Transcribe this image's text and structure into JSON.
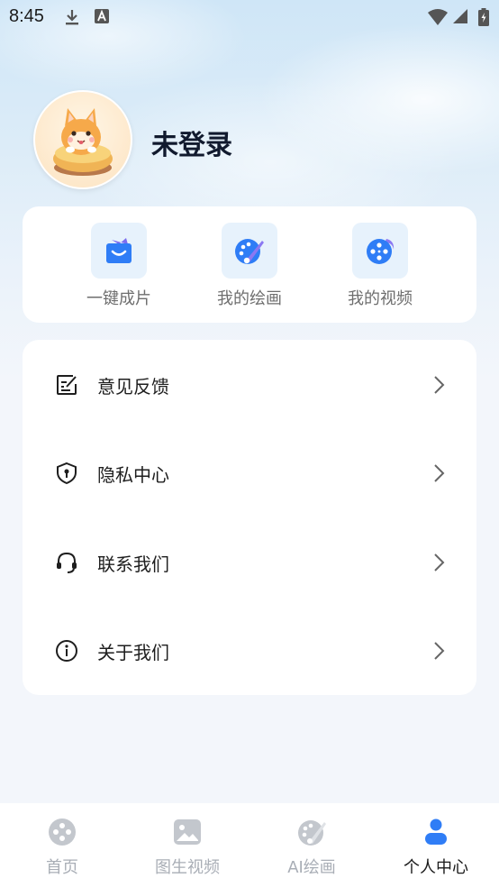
{
  "status_bar": {
    "time": "8:45",
    "icons": [
      "download-icon",
      "font-a-icon",
      "wifi-icon",
      "cell-signal-icon",
      "battery-charging-icon"
    ]
  },
  "profile": {
    "username": "未登录",
    "avatar": "cat-on-donut-avatar"
  },
  "quick_actions": [
    {
      "label": "一键成片",
      "icon": "shopping-bag-smile-icon"
    },
    {
      "label": "我的绘画",
      "icon": "palette-brush-icon"
    },
    {
      "label": "我的视频",
      "icon": "film-reel-bubble-icon"
    }
  ],
  "menu": [
    {
      "label": "意见反馈",
      "icon": "edit-note-icon"
    },
    {
      "label": "隐私中心",
      "icon": "shield-lock-icon"
    },
    {
      "label": "联系我们",
      "icon": "headset-icon"
    },
    {
      "label": "关于我们",
      "icon": "info-circle-icon"
    }
  ],
  "bottom_nav": [
    {
      "label": "首页",
      "icon": "film-reel-icon",
      "active": false
    },
    {
      "label": "图生视频",
      "icon": "image-icon",
      "active": false
    },
    {
      "label": "AI绘画",
      "icon": "palette-icon",
      "active": false
    },
    {
      "label": "个人中心",
      "icon": "person-icon",
      "active": true
    }
  ],
  "colors": {
    "accent": "#2f7df6",
    "inactive": "#a9aeb6",
    "icon_bg": "#e7f2fc"
  }
}
